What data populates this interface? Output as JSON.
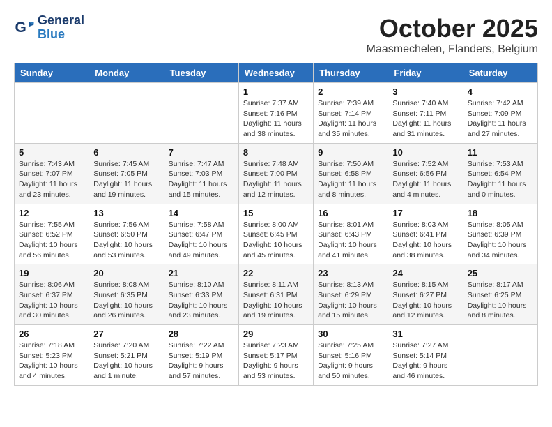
{
  "header": {
    "logo_general": "General",
    "logo_blue": "Blue",
    "month": "October 2025",
    "location": "Maasmechelen, Flanders, Belgium"
  },
  "weekdays": [
    "Sunday",
    "Monday",
    "Tuesday",
    "Wednesday",
    "Thursday",
    "Friday",
    "Saturday"
  ],
  "weeks": [
    [
      {
        "day": "",
        "info": ""
      },
      {
        "day": "",
        "info": ""
      },
      {
        "day": "",
        "info": ""
      },
      {
        "day": "1",
        "info": "Sunrise: 7:37 AM\nSunset: 7:16 PM\nDaylight: 11 hours\nand 38 minutes."
      },
      {
        "day": "2",
        "info": "Sunrise: 7:39 AM\nSunset: 7:14 PM\nDaylight: 11 hours\nand 35 minutes."
      },
      {
        "day": "3",
        "info": "Sunrise: 7:40 AM\nSunset: 7:11 PM\nDaylight: 11 hours\nand 31 minutes."
      },
      {
        "day": "4",
        "info": "Sunrise: 7:42 AM\nSunset: 7:09 PM\nDaylight: 11 hours\nand 27 minutes."
      }
    ],
    [
      {
        "day": "5",
        "info": "Sunrise: 7:43 AM\nSunset: 7:07 PM\nDaylight: 11 hours\nand 23 minutes."
      },
      {
        "day": "6",
        "info": "Sunrise: 7:45 AM\nSunset: 7:05 PM\nDaylight: 11 hours\nand 19 minutes."
      },
      {
        "day": "7",
        "info": "Sunrise: 7:47 AM\nSunset: 7:03 PM\nDaylight: 11 hours\nand 15 minutes."
      },
      {
        "day": "8",
        "info": "Sunrise: 7:48 AM\nSunset: 7:00 PM\nDaylight: 11 hours\nand 12 minutes."
      },
      {
        "day": "9",
        "info": "Sunrise: 7:50 AM\nSunset: 6:58 PM\nDaylight: 11 hours\nand 8 minutes."
      },
      {
        "day": "10",
        "info": "Sunrise: 7:52 AM\nSunset: 6:56 PM\nDaylight: 11 hours\nand 4 minutes."
      },
      {
        "day": "11",
        "info": "Sunrise: 7:53 AM\nSunset: 6:54 PM\nDaylight: 11 hours\nand 0 minutes."
      }
    ],
    [
      {
        "day": "12",
        "info": "Sunrise: 7:55 AM\nSunset: 6:52 PM\nDaylight: 10 hours\nand 56 minutes."
      },
      {
        "day": "13",
        "info": "Sunrise: 7:56 AM\nSunset: 6:50 PM\nDaylight: 10 hours\nand 53 minutes."
      },
      {
        "day": "14",
        "info": "Sunrise: 7:58 AM\nSunset: 6:47 PM\nDaylight: 10 hours\nand 49 minutes."
      },
      {
        "day": "15",
        "info": "Sunrise: 8:00 AM\nSunset: 6:45 PM\nDaylight: 10 hours\nand 45 minutes."
      },
      {
        "day": "16",
        "info": "Sunrise: 8:01 AM\nSunset: 6:43 PM\nDaylight: 10 hours\nand 41 minutes."
      },
      {
        "day": "17",
        "info": "Sunrise: 8:03 AM\nSunset: 6:41 PM\nDaylight: 10 hours\nand 38 minutes."
      },
      {
        "day": "18",
        "info": "Sunrise: 8:05 AM\nSunset: 6:39 PM\nDaylight: 10 hours\nand 34 minutes."
      }
    ],
    [
      {
        "day": "19",
        "info": "Sunrise: 8:06 AM\nSunset: 6:37 PM\nDaylight: 10 hours\nand 30 minutes."
      },
      {
        "day": "20",
        "info": "Sunrise: 8:08 AM\nSunset: 6:35 PM\nDaylight: 10 hours\nand 26 minutes."
      },
      {
        "day": "21",
        "info": "Sunrise: 8:10 AM\nSunset: 6:33 PM\nDaylight: 10 hours\nand 23 minutes."
      },
      {
        "day": "22",
        "info": "Sunrise: 8:11 AM\nSunset: 6:31 PM\nDaylight: 10 hours\nand 19 minutes."
      },
      {
        "day": "23",
        "info": "Sunrise: 8:13 AM\nSunset: 6:29 PM\nDaylight: 10 hours\nand 15 minutes."
      },
      {
        "day": "24",
        "info": "Sunrise: 8:15 AM\nSunset: 6:27 PM\nDaylight: 10 hours\nand 12 minutes."
      },
      {
        "day": "25",
        "info": "Sunrise: 8:17 AM\nSunset: 6:25 PM\nDaylight: 10 hours\nand 8 minutes."
      }
    ],
    [
      {
        "day": "26",
        "info": "Sunrise: 7:18 AM\nSunset: 5:23 PM\nDaylight: 10 hours\nand 4 minutes."
      },
      {
        "day": "27",
        "info": "Sunrise: 7:20 AM\nSunset: 5:21 PM\nDaylight: 10 hours\nand 1 minute."
      },
      {
        "day": "28",
        "info": "Sunrise: 7:22 AM\nSunset: 5:19 PM\nDaylight: 9 hours\nand 57 minutes."
      },
      {
        "day": "29",
        "info": "Sunrise: 7:23 AM\nSunset: 5:17 PM\nDaylight: 9 hours\nand 53 minutes."
      },
      {
        "day": "30",
        "info": "Sunrise: 7:25 AM\nSunset: 5:16 PM\nDaylight: 9 hours\nand 50 minutes."
      },
      {
        "day": "31",
        "info": "Sunrise: 7:27 AM\nSunset: 5:14 PM\nDaylight: 9 hours\nand 46 minutes."
      },
      {
        "day": "",
        "info": ""
      }
    ]
  ]
}
